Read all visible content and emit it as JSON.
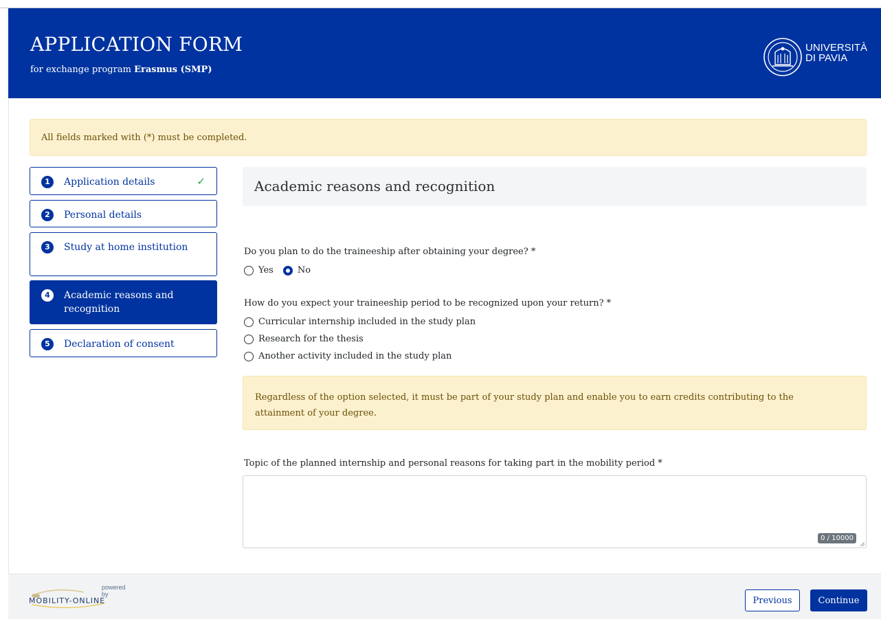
{
  "header": {
    "title": "APPLICATION FORM",
    "subtitle_prefix": "for exchange program",
    "subtitle_program": "Erasmus (SMP)",
    "university_line1": "UNIVERSITÀ",
    "university_line2": "DI PAVIA"
  },
  "alert": {
    "text": "All fields marked with (*) must be completed."
  },
  "steps": [
    {
      "number": "1",
      "label": "Application details",
      "completed": true
    },
    {
      "number": "2",
      "label": "Personal details"
    },
    {
      "number": "3",
      "label": "Study at home institution"
    },
    {
      "number": "4",
      "label": "Academic reasons and recognition",
      "active": true
    },
    {
      "number": "5",
      "label": "Declaration of consent"
    }
  ],
  "section": {
    "title": "Academic reasons and recognition"
  },
  "question1": {
    "label": "Do you plan to do the traineeship after obtaining your degree? *",
    "options": [
      "Yes",
      "No"
    ],
    "selected": "No"
  },
  "question2": {
    "label": "How do you expect your traineeship period to be recognized upon your return? *",
    "options": [
      "Curricular internship included in the study plan",
      "Research for the thesis",
      "Another activity included in the study plan"
    ]
  },
  "info": {
    "text": "Regardless of the option selected, it must be part of your study plan and enable you to earn credits contributing to the attainment of your degree."
  },
  "topic": {
    "label": "Topic of the planned internship and personal reasons for taking part in the mobility period *",
    "value": "",
    "counter": "0 / 10000"
  },
  "footer": {
    "powered_by": "powered by",
    "brand": "MOBILITY-ONLINE",
    "previous_label": "Previous",
    "continue_label": "Continue"
  },
  "colors": {
    "primary": "#0033a0",
    "warning_bg": "#fcf1cf",
    "check": "#2ba34a"
  }
}
